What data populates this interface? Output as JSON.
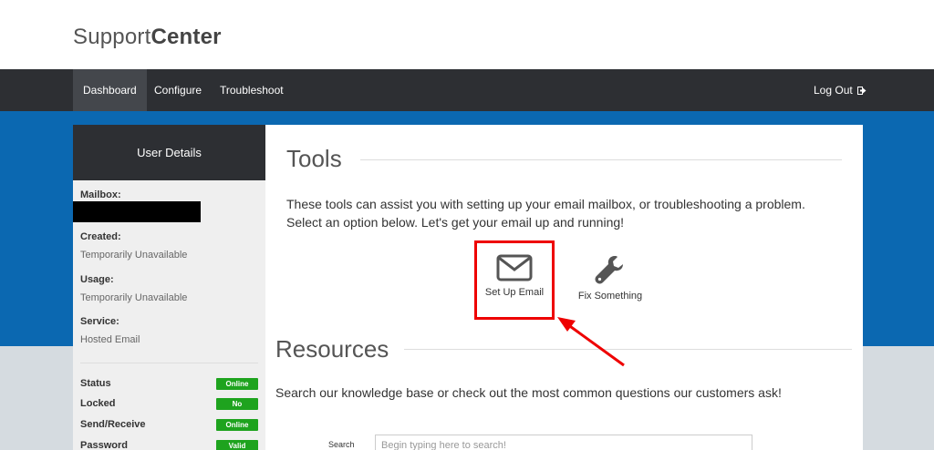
{
  "brand": {
    "part1": "Support",
    "part2": "Center"
  },
  "nav": {
    "items": [
      {
        "label": "Dashboard",
        "active": true
      },
      {
        "label": "Configure",
        "active": false
      },
      {
        "label": "Troubleshoot",
        "active": false
      }
    ],
    "logout_label": "Log Out"
  },
  "sidebar": {
    "title": "User Details",
    "fields": [
      {
        "label": "Mailbox:",
        "value": ""
      },
      {
        "label": "Created:",
        "value": "Temporarily Unavailable"
      },
      {
        "label": "Usage:",
        "value": "Temporarily Unavailable"
      },
      {
        "label": "Service:",
        "value": "Hosted Email"
      }
    ],
    "statuses": [
      {
        "label": "Status",
        "badge": "Online"
      },
      {
        "label": "Locked",
        "badge": "No"
      },
      {
        "label": "Send/Receive",
        "badge": "Online"
      },
      {
        "label": "Password",
        "badge": "Valid"
      }
    ]
  },
  "tools": {
    "title": "Tools",
    "description": "These tools can assist you with setting up your email mailbox, or troubleshooting a problem. Select an option below. Let's get your email up and running!",
    "items": [
      {
        "label": "Set Up Email",
        "icon": "envelope-icon"
      },
      {
        "label": "Fix Something",
        "icon": "wrench-icon"
      }
    ]
  },
  "resources": {
    "title": "Resources",
    "description": "Search our knowledge base or check out the most common questions our customers ask!",
    "search_label": "Search",
    "search_placeholder": "Begin typing here to search!"
  },
  "colors": {
    "navbar": "#2d2f33",
    "accent_blue": "#0b68b1",
    "badge_green": "#1ea31e",
    "highlight_red": "#e00000"
  }
}
